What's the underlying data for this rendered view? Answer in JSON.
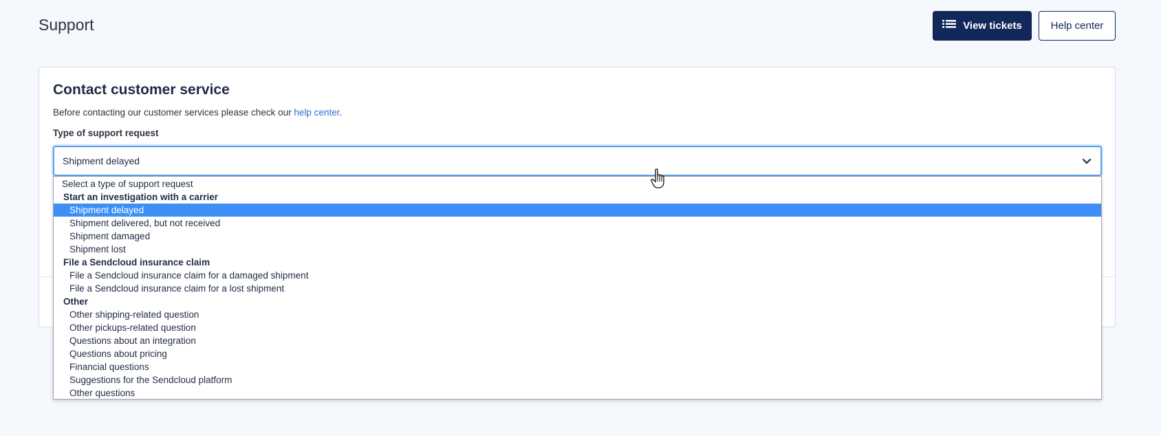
{
  "header": {
    "title": "Support",
    "view_tickets_label": "View tickets",
    "help_center_label": "Help center"
  },
  "card": {
    "title": "Contact customer service",
    "description_prefix": "Before contacting our customer services please check our ",
    "description_link": "help center",
    "description_suffix": ".",
    "field_label": "Type of support request"
  },
  "select": {
    "selected_value": "Shipment delayed",
    "placeholder_option": "Select a type of support request",
    "groups": [
      {
        "label": "Start an investigation with a carrier",
        "options": [
          "Shipment delayed",
          "Shipment delivered, but not received",
          "Shipment damaged",
          "Shipment lost"
        ]
      },
      {
        "label": "File a Sendcloud insurance claim",
        "options": [
          "File a Sendcloud insurance claim for a damaged shipment",
          "File a Sendcloud insurance claim for a lost shipment"
        ]
      },
      {
        "label": "Other",
        "options": [
          "Other shipping-related question",
          "Other pickups-related question",
          "Questions about an integration",
          "Questions about pricing",
          "Financial questions",
          "Suggestions for the Sendcloud platform",
          "Other questions"
        ]
      }
    ]
  },
  "colors": {
    "primary": "#12275a",
    "link": "#2f6fd6",
    "selection": "#3d8ff5",
    "focus": "#5aa1ec"
  },
  "icons": {
    "view_tickets": "list-icon",
    "select_toggle": "chevron-down-icon",
    "cursor": "hand-pointer-icon"
  }
}
